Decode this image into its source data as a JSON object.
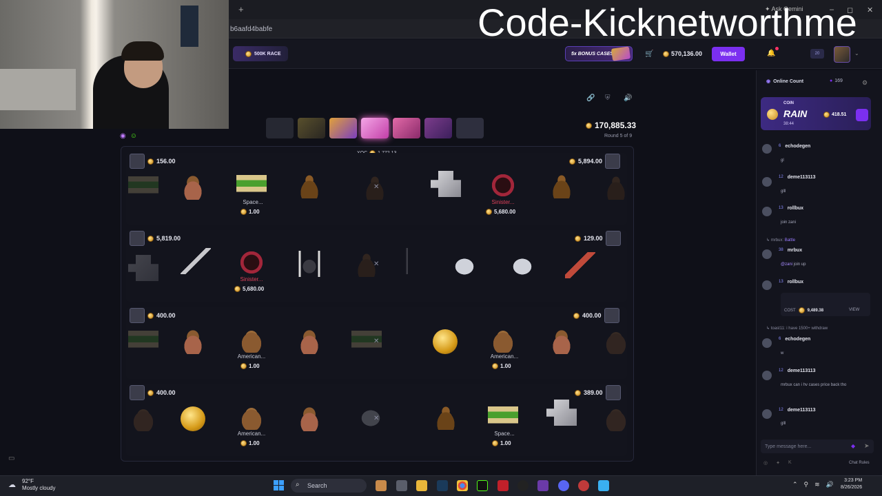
{
  "browser": {
    "url": "b6aafd4babfe",
    "ask_label": "Ask Gemini"
  },
  "watermark": "Code-Kicknetworthme",
  "header": {
    "race_label": "500K RACE",
    "bonus_label": "5x BONUS CASES",
    "balance": "570,136.00",
    "wallet_label": "Wallet",
    "level": "20"
  },
  "battle": {
    "pot": "170,885.33",
    "round": "Round 5 of 9",
    "xqc_label": "XQC",
    "xqc_value": "1,772.13",
    "rows": [
      {
        "left_amount": "156.00",
        "right_amount": "5,894.00",
        "items": [
          {
            "name": "Space...",
            "value": "1.00"
          },
          {
            "name": "Sinister...",
            "value": "5,680.00"
          }
        ]
      },
      {
        "left_amount": "5,819.00",
        "right_amount": "129.00",
        "items": [
          {
            "name": "Sinister...",
            "value": "5,680.00"
          }
        ]
      },
      {
        "left_amount": "400.00",
        "right_amount": "400.00",
        "items": [
          {
            "name": "American...",
            "value": "1.00"
          },
          {
            "name": "American...",
            "value": "1.00"
          }
        ]
      },
      {
        "left_amount": "400.00",
        "right_amount": "389.00",
        "items": [
          {
            "name": "American...",
            "value": "1.00"
          },
          {
            "name": "Space...",
            "value": "1.00"
          }
        ]
      }
    ]
  },
  "chat": {
    "online_label": "Online Count",
    "online_count": "169",
    "rain": {
      "coin_label": "COIN",
      "title": "RAIN",
      "time": "38:44",
      "amount": "418.51"
    },
    "messages": [
      {
        "level": "6",
        "user": "echodegen",
        "text": "gl"
      },
      {
        "level": "12",
        "user": "deme113113",
        "text": "glll"
      },
      {
        "level": "13",
        "user": "rollbux",
        "text": "join zani"
      },
      {
        "reply_user": "mrbux:",
        "reply_text": "Battle",
        "level": "38",
        "user": "mrbux",
        "mention": "@zani",
        "text": " join up"
      },
      {
        "level": "13",
        "user": "rollbux",
        "cost_label": "COST",
        "cost": "9,489.38",
        "view": "VIEW"
      },
      {
        "reply_user": "toast11:",
        "reply_text": "i have 1500+ withdraw",
        "level": "6",
        "user": "echodegen",
        "text": "w"
      },
      {
        "level": "12",
        "user": "deme113113",
        "text": "mrbux can i hv cases price back tho"
      },
      {
        "level": "12",
        "user": "deme113113",
        "text": "glll"
      }
    ],
    "input_placeholder": "Type message here...",
    "rules_label": "Chat Rules"
  },
  "taskbar": {
    "temp": "92°F",
    "weather": "Mostly cloudy",
    "search": "Search",
    "time": "3:23 PM",
    "date": "8/26/2026"
  }
}
